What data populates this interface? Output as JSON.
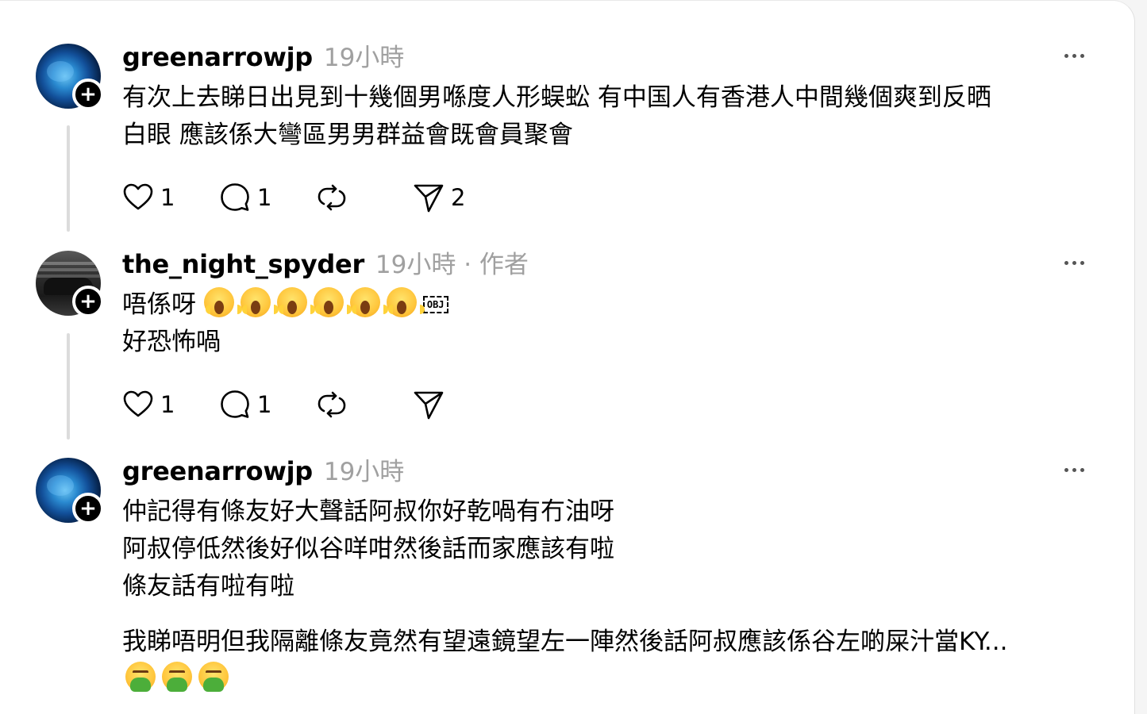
{
  "posts": [
    {
      "username": "greenarrowjp",
      "meta": "19小時",
      "lines": [
        "有次上去睇日出見到十幾個男喺度人形蜈蚣 有中国人有香港人中間幾個爽到反晒",
        "白眼 應該係大彎區男男群益會既會員聚會"
      ],
      "likes": "1",
      "replies": "1",
      "reposts": "",
      "shares": "2"
    },
    {
      "username": "the_night_spyder",
      "meta": "19小時 · 作者",
      "line1_text": "唔係呀",
      "line1_obj": "OBJ",
      "line2": "好恐怖喎",
      "likes": "1",
      "replies": "1",
      "reposts": "",
      "shares": ""
    },
    {
      "username": "greenarrowjp",
      "meta": "19小時",
      "lines": [
        "仲記得有條友好大聲話阿叔你好乾喎有冇油呀",
        "阿叔停低然後好似谷咩咁然後話而家應該有啦",
        "條友話有啦有啦"
      ],
      "line4": "我睇唔明但我隔離條友竟然有望遠鏡望左一陣然後話阿叔應該係谷左啲屎汁當KY..."
    }
  ],
  "icons": {
    "like": "heart-icon",
    "reply": "comment-icon",
    "repost": "repost-icon",
    "share": "send-icon",
    "emoji_scream": "face-screaming-in-fear-emoji",
    "emoji_vomit": "face-vomiting-emoji"
  }
}
